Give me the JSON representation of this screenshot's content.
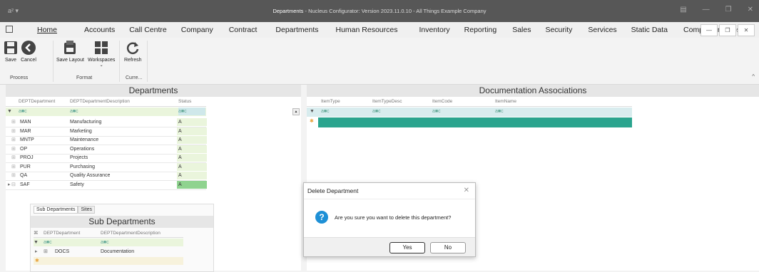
{
  "window": {
    "logo": "a² ▾",
    "title_strong": "Departments",
    "title_rest": " - Nucleus Configurator: Version 2023.11.0.10 - All Things Example Company",
    "min": "—",
    "max": "❐",
    "close": "✕"
  },
  "menu": {
    "items": [
      "Home",
      "Accounts",
      "Call Centre",
      "Company",
      "Contract",
      "Departments",
      "Human Resources",
      "Inventory",
      "Reporting",
      "Sales",
      "Security",
      "Services",
      "Static Data",
      "Companion Apps"
    ],
    "mdi_min": "—",
    "mdi_restore": "❐",
    "mdi_close": "✕"
  },
  "ribbon": {
    "save": "Save",
    "cancel": "Cancel",
    "save_layout": "Save Layout",
    "workspaces": "Workspaces",
    "refresh": "Refresh",
    "group_process": "Process",
    "group_format": "Format",
    "group_curre": "Curre...",
    "collapse": "^"
  },
  "departments": {
    "title": "Departments",
    "columns": [
      "DEPTDepartment",
      "DEPTDepartmentDescription",
      "Status"
    ],
    "rows": [
      {
        "code": "MAN",
        "desc": "Manufacturing",
        "status": "A"
      },
      {
        "code": "MAR",
        "desc": "Marketing",
        "status": "A"
      },
      {
        "code": "MNTP",
        "desc": "Maintenance",
        "status": "A"
      },
      {
        "code": "OP",
        "desc": "Operations",
        "status": "A"
      },
      {
        "code": "PROJ",
        "desc": "Projects",
        "status": "A"
      },
      {
        "code": "PUR",
        "desc": "Purchasing",
        "status": "A"
      },
      {
        "code": "QA",
        "desc": "Quality Assurance",
        "status": "A"
      },
      {
        "code": "SAF",
        "desc": "Safety",
        "status": "A"
      }
    ],
    "filter_glyph": "a■c"
  },
  "subdept": {
    "tab1": "Sub Departments",
    "tab2": "Sites",
    "title": "Sub Departments",
    "columns": [
      "DEPTDepartment",
      "DEPTDepartmentDescription"
    ],
    "row": {
      "code": "DOCS",
      "desc": "Documentation"
    }
  },
  "docassoc": {
    "title": "Documentation Associations",
    "columns": [
      "ItemType",
      "ItemTypeDesc",
      "ItemCode",
      "ItemName"
    ]
  },
  "dialog": {
    "title": "Delete Department",
    "message": "Are you sure you want to delete this department?",
    "yes": "Yes",
    "no": "No",
    "icon": "?",
    "close": "✕"
  }
}
